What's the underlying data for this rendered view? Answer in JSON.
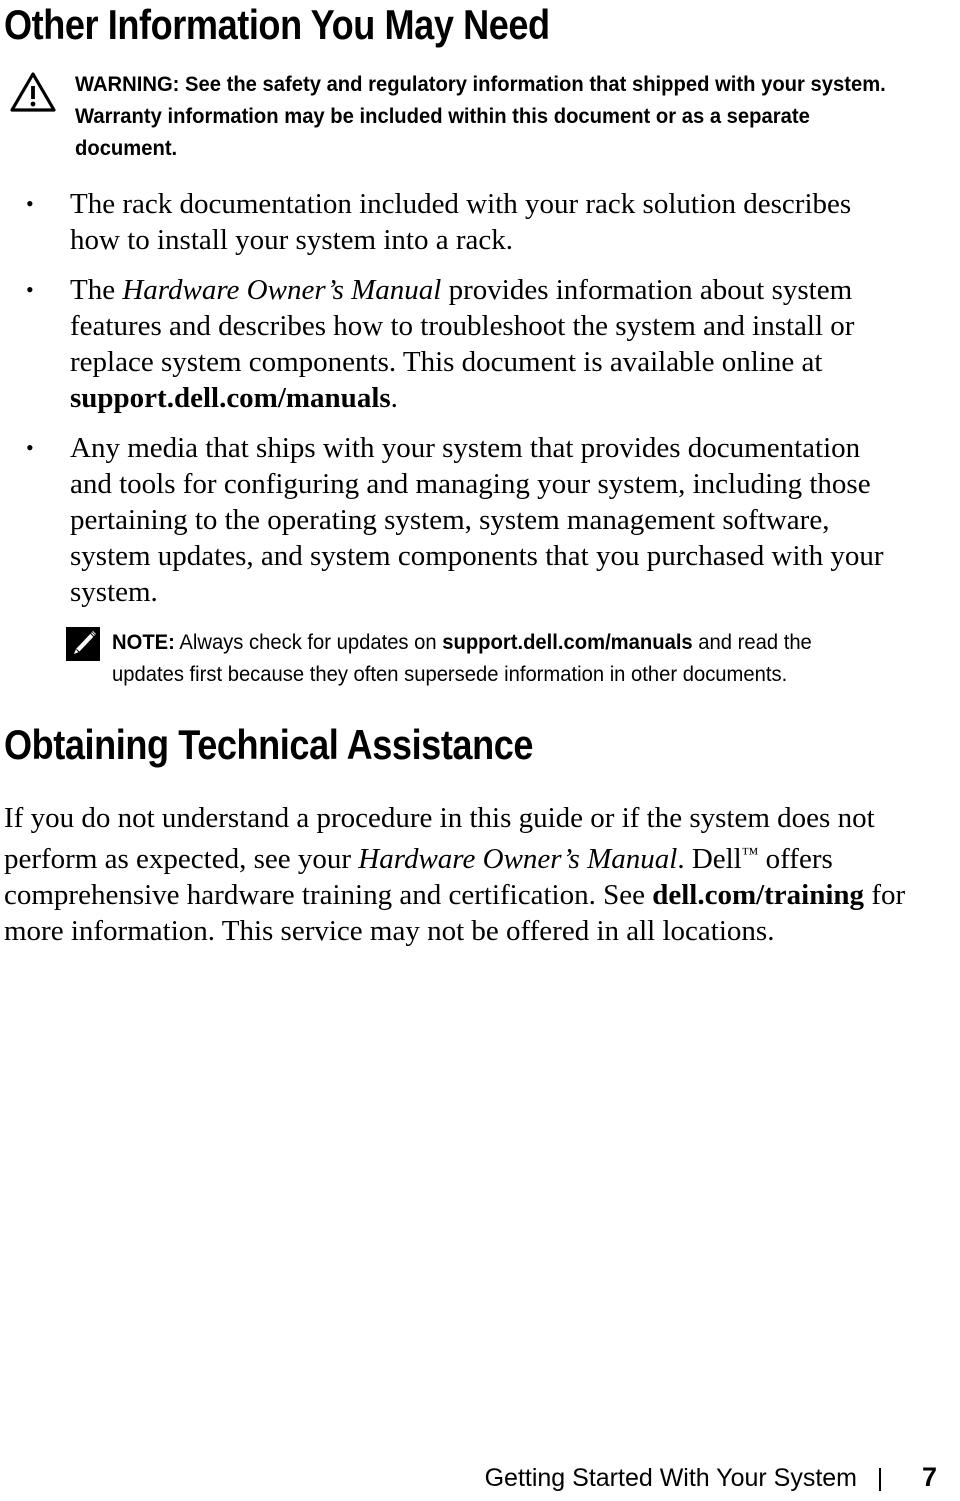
{
  "page": {
    "title": "Other Information You May Need",
    "section_title": "Obtaining Technical Assistance"
  },
  "warning": {
    "icon": "warning-triangle-icon",
    "label": "WARNING:",
    "text": " See the safety and regulatory information that shipped with your system. Warranty information may be included within this document or as a separate document."
  },
  "bullets": [
    {
      "marker": "•",
      "segments": [
        {
          "style": "normal",
          "text": "The rack documentation included with your rack solution describes how to install your system into a rack."
        }
      ]
    },
    {
      "marker": "•",
      "segments": [
        {
          "style": "normal",
          "text": "The "
        },
        {
          "style": "italic",
          "text": "Hardware Owner’s Manual"
        },
        {
          "style": "normal",
          "text": " provides information about system features and describes how to troubleshoot the system and install or replace system components. This document is available online at "
        },
        {
          "style": "bold",
          "text": "support.dell.com/manuals"
        },
        {
          "style": "normal",
          "text": "."
        }
      ]
    },
    {
      "marker": "•",
      "segments": [
        {
          "style": "normal",
          "text": "Any media that ships with your system that provides documentation and tools for configuring and managing your system, including those pertaining to the operating system, system management software, system updates, and system components that you purchased with your system."
        }
      ]
    }
  ],
  "note": {
    "icon": "note-pencil-icon",
    "label": "NOTE:",
    "text_before": " Always check for updates on ",
    "link": "support.dell.com/manuals",
    "text_after": " and read the updates first because they often supersede information in other documents."
  },
  "assistance_paragraph": {
    "segments": [
      {
        "style": "normal",
        "text": "If you do not understand a procedure in this guide or if the system does not perform as expected, see your "
      },
      {
        "style": "italic",
        "text": "Hardware Owner’s Manual"
      },
      {
        "style": "normal",
        "text": ". Dell"
      },
      {
        "style": "trademark",
        "text": "™"
      },
      {
        "style": "normal",
        "text": " offers comprehensive hardware training and certification. See "
      },
      {
        "style": "bold",
        "text": "dell.com/training"
      },
      {
        "style": "normal",
        "text": " for more information. This service may not be offered in all locations."
      }
    ]
  },
  "footer": {
    "title": "Getting Started With Your System",
    "separator": "|",
    "page_number": "7"
  }
}
